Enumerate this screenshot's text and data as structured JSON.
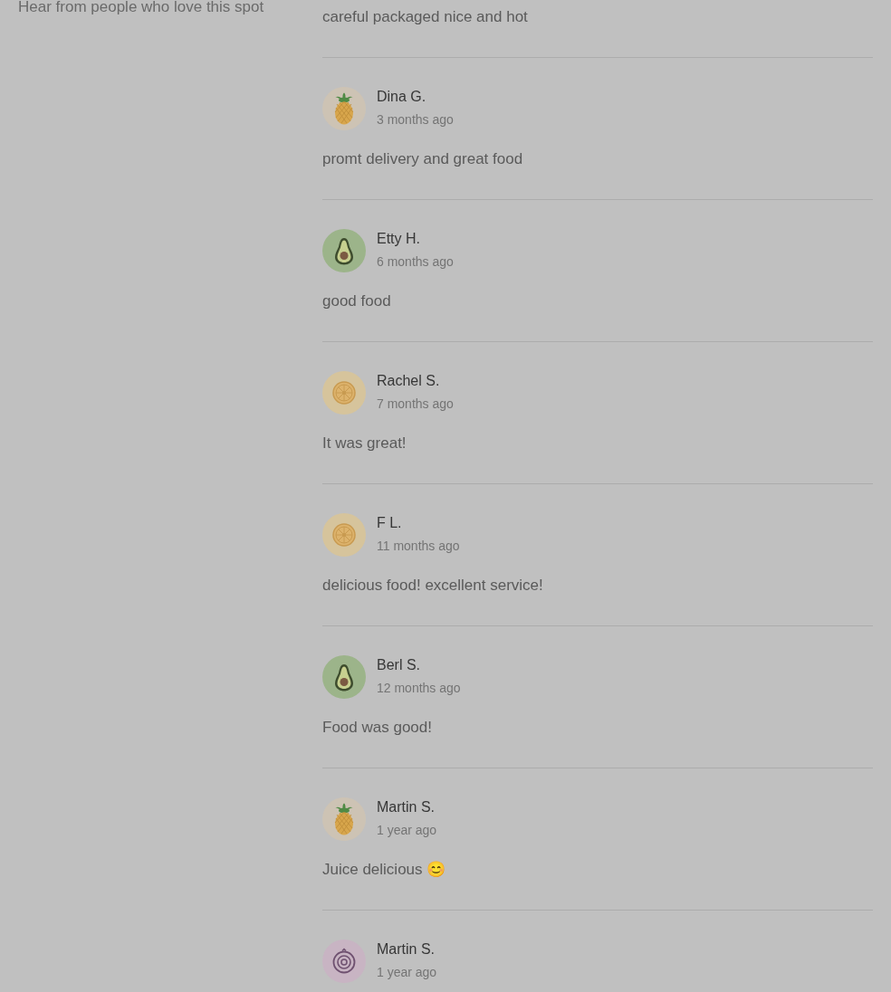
{
  "sidebar": {
    "subtitle": "Hear from people who love this spot"
  },
  "reviews": [
    {
      "text": "careful packaged nice and hot"
    },
    {
      "name": "Dina G.",
      "time": "3 months ago",
      "avatar": {
        "kind": "pineapple"
      },
      "text": "promt delivery and great food"
    },
    {
      "name": "Etty H.",
      "time": "6 months ago",
      "avatar": {
        "kind": "avocado"
      },
      "text": "good food"
    },
    {
      "name": "Rachel S.",
      "time": "7 months ago",
      "avatar": {
        "kind": "citrus"
      },
      "text": "It was great!"
    },
    {
      "name": "F L.",
      "time": "11 months ago",
      "avatar": {
        "kind": "citrus"
      },
      "text": "delicious food! excellent service!"
    },
    {
      "name": "Berl S.",
      "time": "12 months ago",
      "avatar": {
        "kind": "avocado"
      },
      "text": "Food was good!"
    },
    {
      "name": "Martin S.",
      "time": "1 year ago",
      "avatar": {
        "kind": "pineapple"
      },
      "text": "Juice delicious 😊"
    },
    {
      "name": "Martin S.",
      "time": "1 year ago",
      "avatar": {
        "kind": "onion"
      }
    }
  ]
}
